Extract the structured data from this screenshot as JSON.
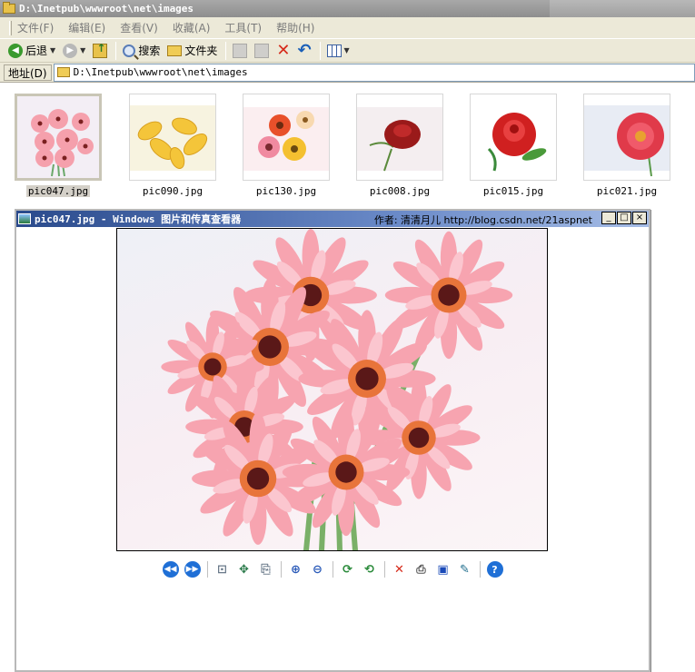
{
  "window": {
    "title": "D:\\Inetpub\\wwwroot\\net\\images"
  },
  "menu": {
    "items": [
      "文件(F)",
      "编辑(E)",
      "查看(V)",
      "收藏(A)",
      "工具(T)",
      "帮助(H)"
    ]
  },
  "toolbar": {
    "back_label": "后退",
    "search_label": "搜索",
    "folders_label": "文件夹"
  },
  "address": {
    "label": "地址(D)",
    "value": "D:\\Inetpub\\wwwroot\\net\\images"
  },
  "thumbnails": [
    {
      "name": "pic047.jpg",
      "selected": true,
      "subject": "pink-gerbera"
    },
    {
      "name": "pic090.jpg",
      "selected": false,
      "subject": "yellow-lily"
    },
    {
      "name": "pic130.jpg",
      "selected": false,
      "subject": "mixed-gerbera"
    },
    {
      "name": "pic008.jpg",
      "selected": false,
      "subject": "red-rose"
    },
    {
      "name": "pic015.jpg",
      "selected": false,
      "subject": "red-rose"
    },
    {
      "name": "pic021.jpg",
      "selected": false,
      "subject": "red-gerbera"
    }
  ],
  "viewer": {
    "title": "pic047.jpg - Windows 图片和传真查看器",
    "author": "作者: 清清月儿 http://blog.csdn.net/21aspnet",
    "window_buttons": [
      "_",
      "□",
      "×"
    ]
  },
  "colors": {
    "accent_title": "#2a4a8c",
    "flower_pink": "#f08a9a",
    "toolbar_bg": "#ece9d8"
  }
}
